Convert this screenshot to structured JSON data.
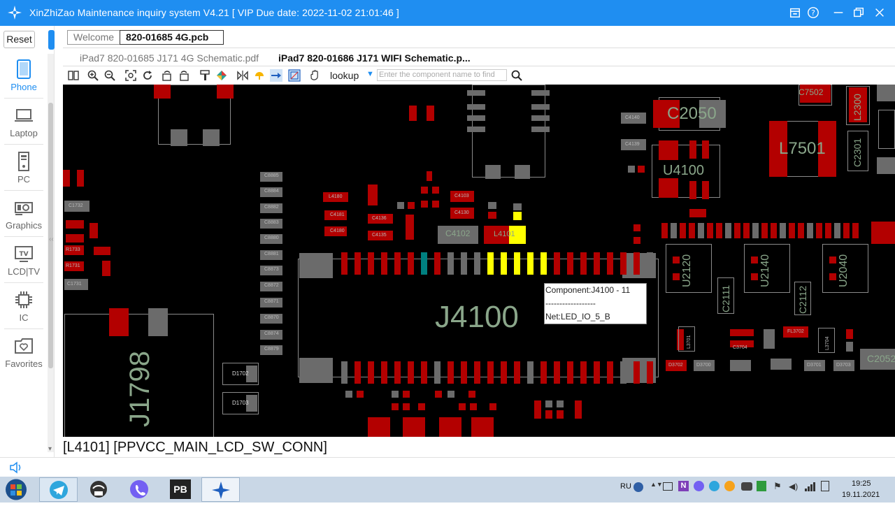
{
  "window": {
    "title": "XinZhiZao Maintenance inquiry system V4.21 [ VIP Due date: 2022-11-02 21:01:46 ]"
  },
  "sidebar": {
    "reset_label": "Reset",
    "items": [
      {
        "label": "Phone",
        "icon": "phone-icon"
      },
      {
        "label": "Laptop",
        "icon": "laptop-icon"
      },
      {
        "label": "PC",
        "icon": "pc-icon"
      },
      {
        "label": "Graphics",
        "icon": "graphics-card-icon"
      },
      {
        "label": "LCD|TV",
        "icon": "tv-icon"
      },
      {
        "label": "IC",
        "icon": "chip-icon"
      },
      {
        "label": "Favorites",
        "icon": "favorites-icon"
      }
    ]
  },
  "tabs": {
    "welcome": "Welcome",
    "pcb": "820-01685 4G.pcb"
  },
  "files": [
    "iPad7 820-01685 J171 4G Schematic.pdf",
    "iPad7 820-01686 J171 WIFI Schematic.p..."
  ],
  "toolbar": {
    "lookup": "lookup",
    "search_placeholder": "Enter the component name to find"
  },
  "board": {
    "big_labels": {
      "j4100": "J4100",
      "j1798": "J1798",
      "c2050": "C2050",
      "u4100": "U4100",
      "l7501": "L7501",
      "c7502": "C7502",
      "l2300": "L2300",
      "c2301": "C2301",
      "c4102": "C4102",
      "l4101": "L4101",
      "c2052": "C2052",
      "u2120": "U2120",
      "u2140": "U2140",
      "u2040": "U2040",
      "c2111": "C2111",
      "c2112": "C2112"
    },
    "small_labels": [
      "C8885",
      "C8884",
      "C8882",
      "C8883",
      "C8880",
      "C8881",
      "C8873",
      "C8872",
      "C8871",
      "C8870",
      "C8874",
      "C8879",
      "L4180",
      "C4181",
      "C4180",
      "C4136",
      "C4135",
      "C4103",
      "C4130",
      "C1732",
      "R1733",
      "R1731",
      "C1731",
      "D1702",
      "D1703",
      "C4140",
      "C4139",
      "C3704",
      "L3701",
      "L3704",
      "FL3702",
      "D3702",
      "D3700",
      "D3701",
      "D3703"
    ],
    "tooltip": {
      "component": "Component:J4100 - 11",
      "separator": "------------------",
      "net": "Net:LED_IO_5_B"
    }
  },
  "status": {
    "text": "[L4101] [PPVCC_MAIN_LCD_SW_CONN]"
  },
  "taskbar": {
    "lang": "RU",
    "time": "19:25",
    "date": "19.11.2021",
    "apps": [
      "start-button",
      "telegram-icon",
      "wifi-tool-icon",
      "viber-icon",
      "pb-app-icon",
      "xinzhizao-icon"
    ],
    "pb_label": "PB"
  },
  "colors": {
    "accent": "#1f8ef1",
    "pad_red": "#b30000",
    "pad_gray": "#6b6b6b",
    "highlight": "#ffff00",
    "board_bg": "#000000"
  }
}
